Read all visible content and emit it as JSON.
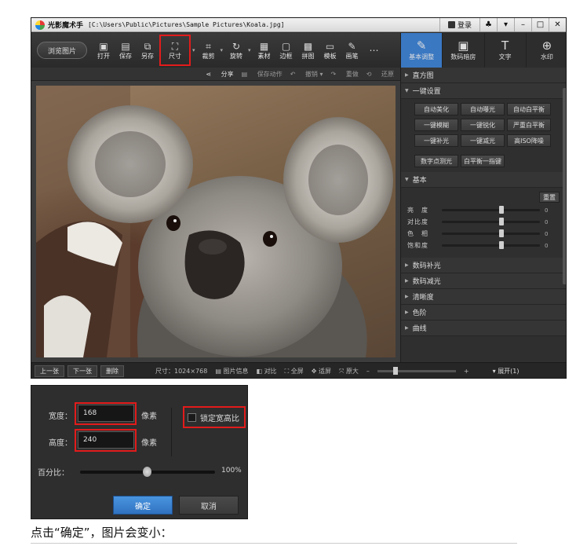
{
  "window": {
    "app_name": "光影魔术手",
    "file_path": "[C:\\Users\\Public\\Pictures\\Sample Pictures\\Koala.jpg]",
    "login_label": "登录",
    "controls": [
      "♣",
      "▾",
      "–",
      "□",
      "✕"
    ]
  },
  "toolbar": {
    "browse_label": "浏览图片",
    "tools": [
      {
        "label": "打开",
        "icon": "open-icon",
        "glyph": "▣"
      },
      {
        "label": "保存",
        "icon": "save-icon",
        "glyph": "▤"
      },
      {
        "label": "另存",
        "icon": "save-as-icon",
        "glyph": "⧉"
      },
      {
        "label": "尺寸",
        "icon": "resize-icon",
        "glyph": "⛶"
      },
      {
        "label": "裁剪",
        "icon": "crop-icon",
        "glyph": "⌗"
      },
      {
        "label": "旋转",
        "icon": "rotate-icon",
        "glyph": "↻"
      },
      {
        "label": "素材",
        "icon": "material-icon",
        "glyph": "▦"
      },
      {
        "label": "边框",
        "icon": "border-icon",
        "glyph": "▢"
      },
      {
        "label": "拼图",
        "icon": "collage-icon",
        "glyph": "▩"
      },
      {
        "label": "模板",
        "icon": "template-icon",
        "glyph": "▭"
      },
      {
        "label": "画笔",
        "icon": "brush-icon",
        "glyph": "✎"
      }
    ],
    "more_glyph": "⋯"
  },
  "right_tabs": [
    {
      "label": "基本调整",
      "icon": "adjust-icon",
      "glyph": "✎"
    },
    {
      "label": "数码暗房",
      "icon": "darkroom-icon",
      "glyph": "▣"
    },
    {
      "label": "文字",
      "icon": "text-icon",
      "glyph": "T"
    },
    {
      "label": "水印",
      "icon": "watermark-icon",
      "glyph": "⊕"
    }
  ],
  "subbar": {
    "share": "分享",
    "save_action": "保存动作",
    "undo": "撤销",
    "redo": "重做",
    "restore": "还原"
  },
  "panel": {
    "histogram": "直方图",
    "one_click": "一键设置",
    "one_click_buttons": [
      "自动美化",
      "自动曝光",
      "自动白平衡",
      "一键模糊",
      "一键锐化",
      "严重白平衡",
      "一键补光",
      "一键减光",
      "高ISO降噪"
    ],
    "extra_buttons": [
      "数字点测光",
      "白平衡一指键"
    ],
    "basic": "基本",
    "reset": "重置",
    "sliders": [
      {
        "label": "亮　度",
        "value": "0"
      },
      {
        "label": "对比度",
        "value": "0"
      },
      {
        "label": "色　相",
        "value": "0"
      },
      {
        "label": "饱和度",
        "value": "0"
      }
    ],
    "sections": [
      "数码补光",
      "数码减光",
      "清晰度",
      "色阶",
      "曲线"
    ]
  },
  "bottom": {
    "prev": "上一张",
    "next": "下一张",
    "delete": "删除",
    "size": "尺寸：1024×768",
    "info": "图片信息",
    "compare": "对比",
    "fullscreen": "全屏",
    "fit": "适屏",
    "original": "原大",
    "zoom_minus": "–",
    "zoom_plus": "+",
    "expand": "展开(1)"
  },
  "dialog": {
    "width_label": "宽度：",
    "width_value": "168",
    "height_label": "高度：",
    "height_value": "240",
    "unit": "像素",
    "lock_label": "锁定宽高比",
    "percent_label": "百分比：",
    "percent_value": "100%",
    "ok": "确定",
    "cancel": "取消"
  },
  "caption": "点击“确定”，图片会变小："
}
